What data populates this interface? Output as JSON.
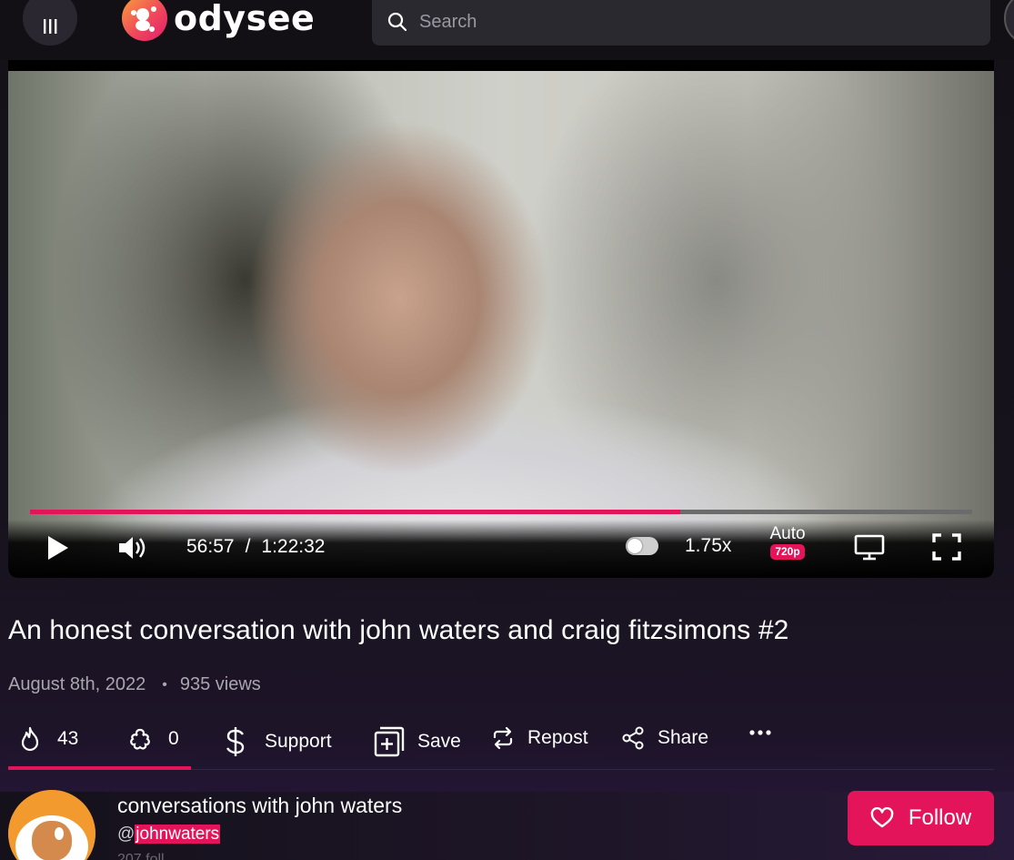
{
  "header": {
    "logo_text": "odysee",
    "search_placeholder": "Search"
  },
  "player": {
    "current_time": "56:57",
    "separator": "/",
    "duration": "1:22:32",
    "progress_fraction": 0.69,
    "speed": "1.75x",
    "quality_label": "Auto",
    "quality_badge": "720p"
  },
  "video": {
    "title": "An honest conversation with john waters and craig fitzsimons #2",
    "date": "August 8th, 2022",
    "views": "935 views"
  },
  "actions": {
    "fire_count": "43",
    "slime_count": "0",
    "support_label": "Support",
    "save_label": "Save",
    "repost_label": "Repost",
    "share_label": "Share"
  },
  "channel": {
    "name": "conversations with john waters",
    "handle_prefix": "@",
    "handle": "johnwaters",
    "followers_partial": "207 foll",
    "follow_label": "Follow"
  },
  "colors": {
    "accent": "#e4145a",
    "background": "#141118"
  }
}
